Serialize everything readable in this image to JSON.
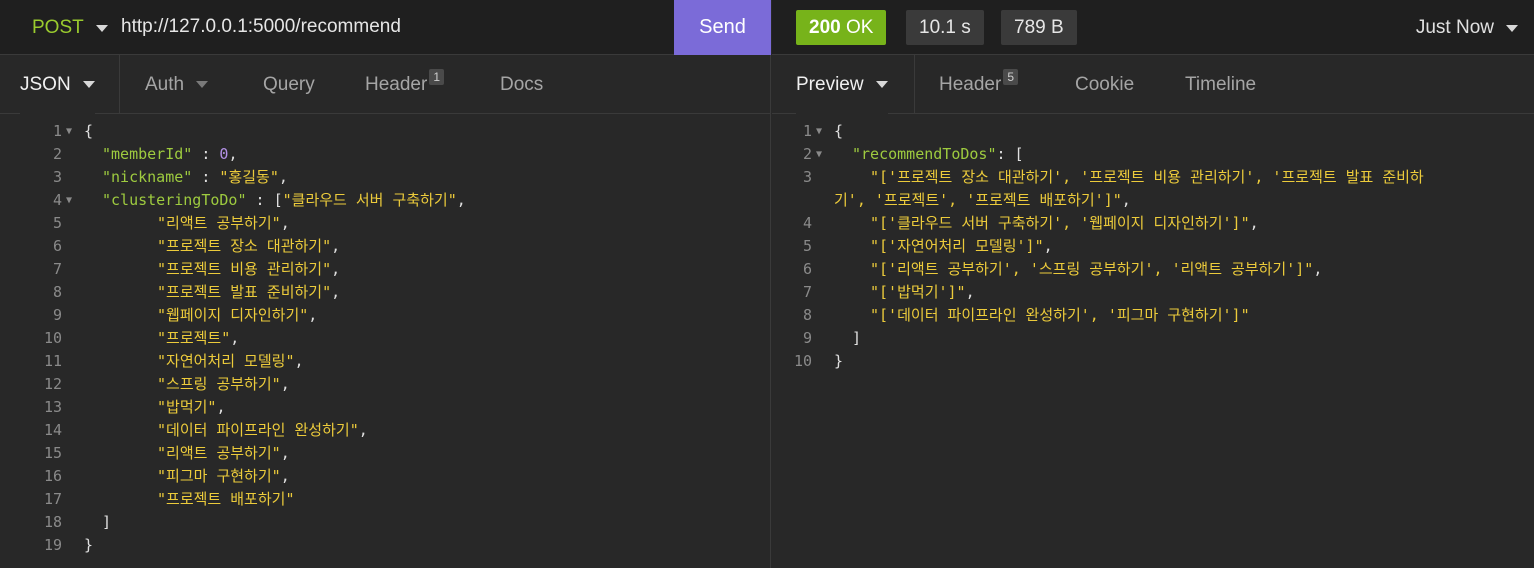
{
  "request": {
    "method": "POST",
    "url": "http://127.0.0.1:5000/recommend",
    "send_label": "Send",
    "tabs": [
      {
        "label": "JSON"
      },
      {
        "label": "Auth"
      },
      {
        "label": "Query"
      },
      {
        "label": "Header",
        "badge": "1"
      },
      {
        "label": "Docs"
      }
    ],
    "body_lines": [
      {
        "num": "1",
        "text": "{"
      },
      {
        "num": "2",
        "key": "\"memberId\"",
        "sep": " : ",
        "numval": "0",
        "tail": ","
      },
      {
        "num": "3",
        "key": "\"nickname\"",
        "sep": " : ",
        "str": "\"홍길동\"",
        "tail": ","
      },
      {
        "num": "4",
        "key": "\"clusteringToDo\"",
        "sep": " : [",
        "str": "\"클라우드 서버 구축하기\"",
        "tail": ","
      },
      {
        "num": "5",
        "str": "\"리액트 공부하기\"",
        "tail": ","
      },
      {
        "num": "6",
        "str": "\"프로젝트 장소 대관하기\"",
        "tail": ","
      },
      {
        "num": "7",
        "str": "\"프로젝트 비용 관리하기\"",
        "tail": ","
      },
      {
        "num": "8",
        "str": "\"프로젝트 발표 준비하기\"",
        "tail": ","
      },
      {
        "num": "9",
        "str": "\"웹페이지 디자인하기\"",
        "tail": ","
      },
      {
        "num": "10",
        "str": "\"프로젝트\"",
        "tail": ","
      },
      {
        "num": "11",
        "str": "\"자연어처리 모델링\"",
        "tail": ","
      },
      {
        "num": "12",
        "str": "\"스프링 공부하기\"",
        "tail": ","
      },
      {
        "num": "13",
        "str": "\"밥먹기\"",
        "tail": ","
      },
      {
        "num": "14",
        "str": "\"데이터 파이프라인 완성하기\"",
        "tail": ","
      },
      {
        "num": "15",
        "str": "\"리액트 공부하기\"",
        "tail": ","
      },
      {
        "num": "16",
        "str": "\"피그마 구현하기\"",
        "tail": ","
      },
      {
        "num": "17",
        "str": "\"프로젝트 배포하기\""
      },
      {
        "num": "18",
        "text": "]"
      },
      {
        "num": "19",
        "text": "}"
      }
    ]
  },
  "response": {
    "status_code": "200",
    "status_text": "OK",
    "time": "10.1 s",
    "size": "789 B",
    "history_label": "Just Now",
    "tabs": [
      {
        "label": "Preview"
      },
      {
        "label": "Header",
        "badge": "5"
      },
      {
        "label": "Cookie"
      },
      {
        "label": "Timeline"
      }
    ],
    "body_lines": [
      {
        "num": "1",
        "text": "{"
      },
      {
        "num": "2",
        "key": "\"recommendToDos\"",
        "sep": ": ["
      },
      {
        "num": "3",
        "str": "\"['프로젝트 장소 대관하기', '프로젝트 비용 관리하기', '프로젝트 발표 준비하"
      },
      {
        "num": "",
        "str": "기', '프로젝트', '프로젝트 배포하기']\"",
        "tail": ","
      },
      {
        "num": "4",
        "str": "\"['클라우드 서버 구축하기', '웹페이지 디자인하기']\"",
        "tail": ","
      },
      {
        "num": "5",
        "str": "\"['자연어처리 모델링']\"",
        "tail": ","
      },
      {
        "num": "6",
        "str": "\"['리액트 공부하기', '스프링 공부하기', '리액트 공부하기']\"",
        "tail": ","
      },
      {
        "num": "7",
        "str": "\"['밥먹기']\"",
        "tail": ","
      },
      {
        "num": "8",
        "str": "\"['데이터 파이프라인 완성하기', '피그마 구현하기']\""
      },
      {
        "num": "9",
        "text": "]"
      },
      {
        "num": "10",
        "text": "}"
      }
    ]
  },
  "colors": {
    "method": "#9acb2e",
    "send": "#7b6bd8",
    "status_ok": "#77b31a",
    "json_key": "#9ecb3f",
    "json_string": "#eccb3b",
    "json_number": "#b391e6"
  }
}
